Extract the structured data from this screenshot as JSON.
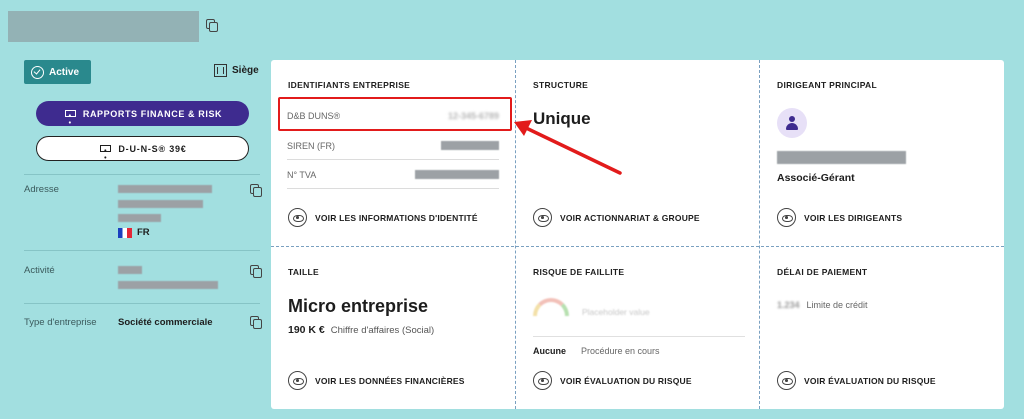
{
  "header": {
    "company_name": "",
    "copy_icon": "copy-icon"
  },
  "left": {
    "status": "Active",
    "siege_label": "Siège",
    "btn_finance": "RAPPORTS FINANCE & RISK",
    "btn_duns": "D-U-N-S® 39€",
    "rows": {
      "adresse_label": "Adresse",
      "country": "FR",
      "activite_label": "Activité",
      "type_label": "Type d'entreprise",
      "type_value": "Société commerciale"
    }
  },
  "identifiants": {
    "title": "IDENTIFIANTS ENTREPRISE",
    "duns_label": "D&B DUNS®",
    "duns_value": "12-345-6789",
    "siren_label": "SIREN (FR)",
    "tva_label": "N° TVA",
    "link": "VOIR LES INFORMATIONS D'IDENTITÉ"
  },
  "structure": {
    "title": "STRUCTURE",
    "value": "Unique",
    "link": "VOIR ACTIONNARIAT & GROUPE"
  },
  "dirigeant": {
    "title": "DIRIGEANT PRINCIPAL",
    "role": "Associé-Gérant",
    "link": "VOIR LES DIRIGEANTS"
  },
  "taille": {
    "title": "TAILLE",
    "value": "Micro entreprise",
    "ca_value": "190 K €",
    "ca_label": "Chiffre d'affaires (Social)",
    "link": "VOIR LES DONNÉES FINANCIÈRES"
  },
  "risque": {
    "title": "RISQUE DE FAILLITE",
    "gauge_placeholder": "Placeholder value",
    "procedure_value": "Aucune",
    "procedure_label": "Procédure en cours",
    "link": "VOIR ÉVALUATION DU RISQUE"
  },
  "paiement": {
    "title": "DÉLAI DE PAIEMENT",
    "credit_value": "1.234",
    "credit_label": "Limite de crédit",
    "link": "VOIR ÉVALUATION DU RISQUE"
  },
  "colors": {
    "background": "#a2dfe0",
    "accent": "#3e2b8f",
    "status": "#2a898d",
    "highlight": "#e21b1b"
  }
}
